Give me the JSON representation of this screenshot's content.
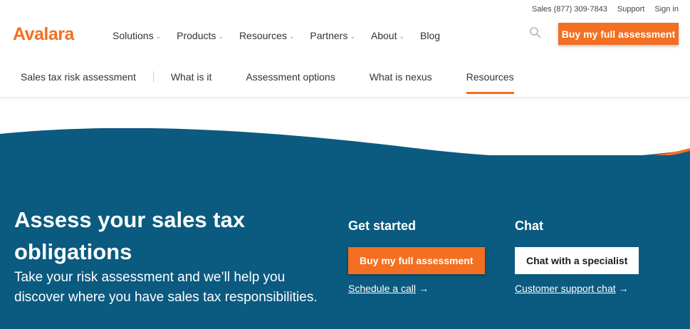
{
  "utility": {
    "sales": "Sales (877) 309-7843",
    "support": "Support",
    "signin": "Sign in"
  },
  "brand": {
    "logo": "Avalara",
    "accent": "#f36f21",
    "hero_bg": "#0b5a80"
  },
  "nav": {
    "items": [
      {
        "label": "Solutions"
      },
      {
        "label": "Products"
      },
      {
        "label": "Resources"
      },
      {
        "label": "Partners"
      },
      {
        "label": "About"
      },
      {
        "label": "Blog"
      }
    ],
    "cta": "Buy my full assessment"
  },
  "subnav": {
    "items": [
      {
        "label": "Sales tax risk assessment"
      },
      {
        "label": "What is it"
      },
      {
        "label": "Assessment options"
      },
      {
        "label": "What is nexus"
      },
      {
        "label": "Resources"
      }
    ]
  },
  "hero": {
    "title": "Assess your sales tax obligations",
    "lead": "Take your risk assessment and we’ll help you discover where you have sales tax responsibilities.",
    "get_started": {
      "heading": "Get started",
      "button": "Buy my full assessment",
      "link": "Schedule a call"
    },
    "chat": {
      "heading": "Chat",
      "button": "Chat with a specialist",
      "link": "Customer support chat"
    }
  }
}
